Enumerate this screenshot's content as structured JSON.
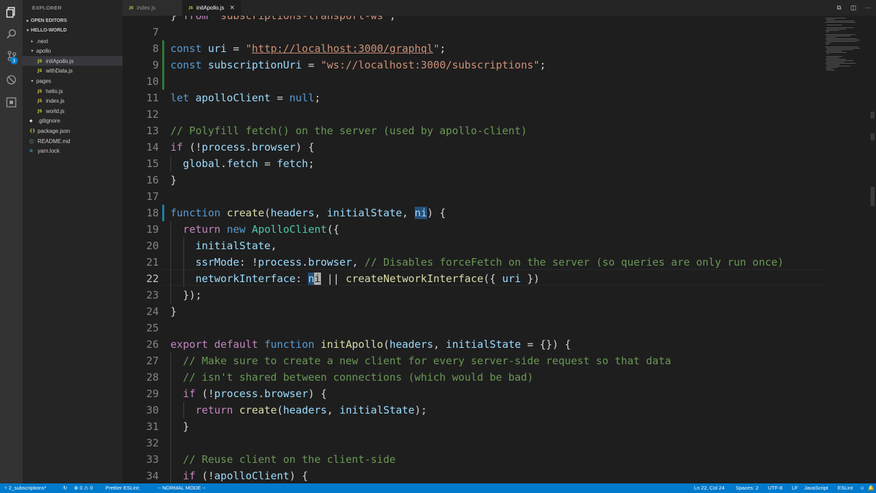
{
  "sidebar": {
    "title": "EXPLORER",
    "open_editors": "OPEN EDITORS",
    "project": "HELLO-WORLD",
    "tree": [
      {
        "label": ".next",
        "depth": 1,
        "type": "folder",
        "expanded": false
      },
      {
        "label": "apollo",
        "depth": 1,
        "type": "folder",
        "expanded": true
      },
      {
        "label": "initApollo.js",
        "depth": 2,
        "type": "js",
        "active": true
      },
      {
        "label": "withData.js",
        "depth": 2,
        "type": "js"
      },
      {
        "label": "pages",
        "depth": 1,
        "type": "folder",
        "expanded": true
      },
      {
        "label": "hello.js",
        "depth": 2,
        "type": "js"
      },
      {
        "label": "index.js",
        "depth": 2,
        "type": "js"
      },
      {
        "label": "world.js",
        "depth": 2,
        "type": "js"
      },
      {
        "label": ".gitignore",
        "depth": 1,
        "type": "git"
      },
      {
        "label": "package.json",
        "depth": 1,
        "type": "json"
      },
      {
        "label": "README.md",
        "depth": 1,
        "type": "md"
      },
      {
        "label": "yarn.lock",
        "depth": 1,
        "type": "yarn"
      }
    ]
  },
  "activity": {
    "scm_badge": "3"
  },
  "tabs": [
    {
      "label": "index.js",
      "active": false
    },
    {
      "label": "initApollo.js",
      "active": true
    }
  ],
  "editor": {
    "partial_top": "} from \"subscriptions-transport-ws\";",
    "line_numbers": [
      "7",
      "8",
      "9",
      "10",
      "11",
      "12",
      "13",
      "14",
      "15",
      "16",
      "17",
      "18",
      "19",
      "20",
      "21",
      "22",
      "23",
      "24",
      "25",
      "26",
      "27",
      "28",
      "29",
      "30",
      "31",
      "32",
      "33",
      "34"
    ],
    "current_line": "22"
  },
  "statusbar": {
    "branch": "2_subscriptions*",
    "errors": "0",
    "warnings": "0",
    "prettier": "Prettier ESLint:",
    "mode": "-- NORMAL MODE --",
    "position": "Ln 22, Col 24",
    "spaces": "Spaces: 2",
    "encoding": "UTF-8",
    "eol": "LF",
    "language": "JavaScript",
    "linter": "ESLint"
  }
}
